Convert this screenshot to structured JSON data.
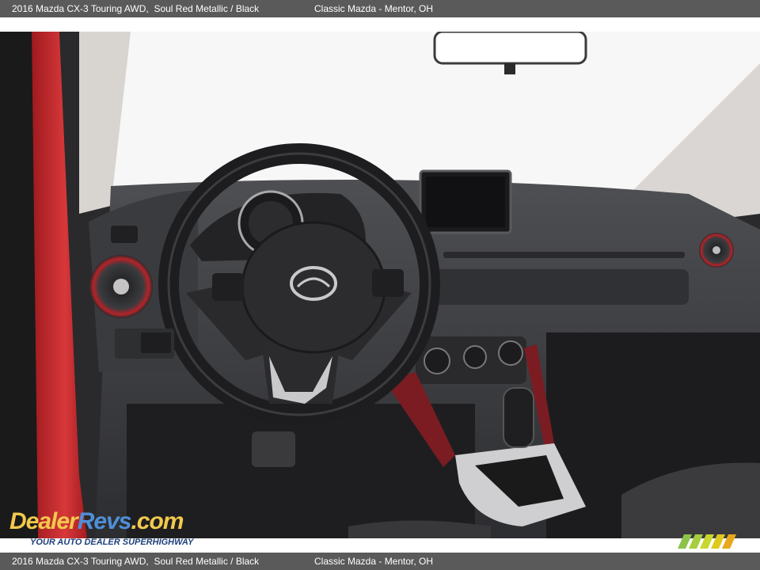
{
  "caption": {
    "vehicle": "2016 Mazda CX-3 Touring AWD,",
    "color": "Soul Red Metallic / Black",
    "dealer": "Classic Mazda - Mentor, OH"
  },
  "photo": {
    "dashboard_logo": "mazda-logo"
  },
  "watermark": {
    "logo_text_a": "Dealer",
    "logo_text_b": "Revs",
    "logo_text_c": ".com",
    "tagline": "YOUR AUTO DEALER SUPERHIGHWAY"
  },
  "colors": {
    "caption_bar": "#5a5a5a",
    "caption_text": "#ffffff",
    "body_red": "#c8262a",
    "dash_grey": "#3a3b3e",
    "stitch_red": "#8c1f24"
  }
}
